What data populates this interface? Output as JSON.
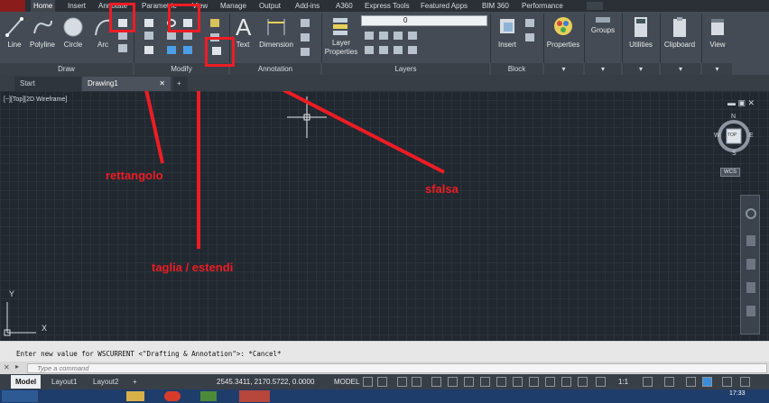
{
  "menu_tabs": [
    "Home",
    "Insert",
    "Annotate",
    "Parametric",
    "View",
    "Manage",
    "Output",
    "Add-ins",
    "A360",
    "Express Tools",
    "Featured Apps",
    "BIM 360",
    "Performance"
  ],
  "ribbon": {
    "draw": {
      "line": "Line",
      "polyline": "Polyline",
      "circle": "Circle",
      "arc": "Arc",
      "title": "Draw"
    },
    "modify": {
      "title": "Modify"
    },
    "annotation": {
      "text": "Text",
      "dimension": "Dimension",
      "title": "Annotation"
    },
    "layers": {
      "layer_properties": "Layer Properties",
      "current_layer": "0",
      "title": "Layers"
    },
    "block": {
      "insert": "Insert",
      "title": "Block"
    },
    "properties": "Properties",
    "groups": "Groups",
    "utilities": "Utilities",
    "clipboard": "Clipboard",
    "view": "View"
  },
  "doc_tabs": {
    "start": "Start",
    "drawing": "Drawing1"
  },
  "viewport": {
    "label": "[−][Top][2D Wireframe]",
    "viewcube": {
      "top": "TOP",
      "n": "N",
      "s": "S",
      "e": "E",
      "w": "W",
      "wcs": "WCS"
    }
  },
  "ucs": {
    "x": "X",
    "y": "Y"
  },
  "annotations": {
    "rettangolo": "rettangolo",
    "taglia": "taglia / estendi",
    "sfalsa": "sfalsa"
  },
  "command": {
    "history": "Enter new value for WSCURRENT <\"Drafting & Annotation\">: *Cancel*",
    "placeholder": "Type a command"
  },
  "layout_tabs": [
    "Model",
    "Layout1",
    "Layout2"
  ],
  "status": {
    "coords": "2545.3411, 2170.5722, 0.0000",
    "model": "MODEL",
    "scale": "1:1"
  },
  "taskbar": {
    "clock": "17:33"
  },
  "colors": {
    "highlight": "#ee1c24",
    "canvas": "#212830",
    "ribbon": "#454b54"
  }
}
